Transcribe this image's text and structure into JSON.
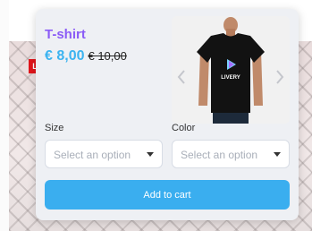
{
  "product": {
    "title": "T-shirt",
    "price_sale": "€ 8,00",
    "price_regular": "€ 10,00",
    "image_print": "LIVERY"
  },
  "options": {
    "size": {
      "label": "Size",
      "placeholder": "Select an option"
    },
    "color": {
      "label": "Color",
      "placeholder": "Select an option"
    }
  },
  "cart": {
    "add_label": "Add to cart"
  },
  "background": {
    "badge": "L"
  },
  "colors": {
    "title": "#8b5cf6",
    "price": "#3bb3f0",
    "button": "#3aaeef",
    "card": "#eef0f4",
    "badge": "#e1151b"
  },
  "icons": {
    "gallery_prev": "chevron-left-icon",
    "gallery_next": "chevron-right-icon",
    "select_caret": "caret-down-icon"
  }
}
